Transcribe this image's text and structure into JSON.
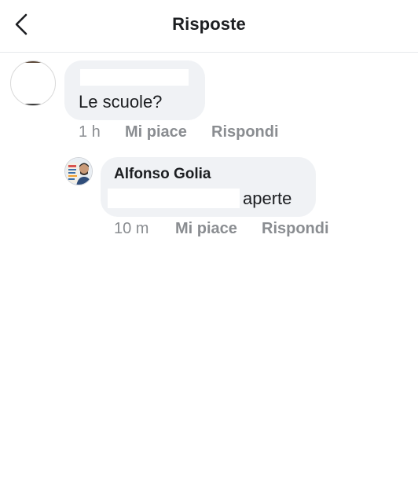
{
  "header": {
    "title": "Risposte"
  },
  "comment": {
    "text": "Le scuole?",
    "time": "1 h",
    "like_label": "Mi piace",
    "reply_label": "Rispondi"
  },
  "reply": {
    "author": "Alfonso Golia",
    "text": "aperte",
    "time": "10 m",
    "like_label": "Mi piace",
    "reply_label": "Rispondi"
  },
  "icons": {
    "back": "chevron-left-icon"
  }
}
